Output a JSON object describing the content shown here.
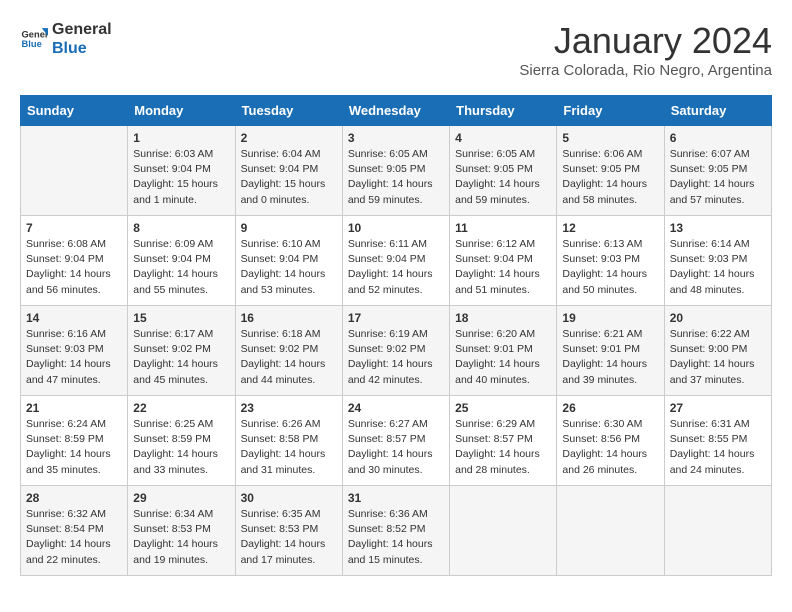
{
  "header": {
    "logo_general": "General",
    "logo_blue": "Blue",
    "month": "January 2024",
    "location": "Sierra Colorada, Rio Negro, Argentina"
  },
  "weekdays": [
    "Sunday",
    "Monday",
    "Tuesday",
    "Wednesday",
    "Thursday",
    "Friday",
    "Saturday"
  ],
  "weeks": [
    [
      {
        "day": "",
        "sunrise": "",
        "sunset": "",
        "daylight": ""
      },
      {
        "day": "1",
        "sunrise": "Sunrise: 6:03 AM",
        "sunset": "Sunset: 9:04 PM",
        "daylight": "Daylight: 15 hours and 1 minute."
      },
      {
        "day": "2",
        "sunrise": "Sunrise: 6:04 AM",
        "sunset": "Sunset: 9:04 PM",
        "daylight": "Daylight: 15 hours and 0 minutes."
      },
      {
        "day": "3",
        "sunrise": "Sunrise: 6:05 AM",
        "sunset": "Sunset: 9:05 PM",
        "daylight": "Daylight: 14 hours and 59 minutes."
      },
      {
        "day": "4",
        "sunrise": "Sunrise: 6:05 AM",
        "sunset": "Sunset: 9:05 PM",
        "daylight": "Daylight: 14 hours and 59 minutes."
      },
      {
        "day": "5",
        "sunrise": "Sunrise: 6:06 AM",
        "sunset": "Sunset: 9:05 PM",
        "daylight": "Daylight: 14 hours and 58 minutes."
      },
      {
        "day": "6",
        "sunrise": "Sunrise: 6:07 AM",
        "sunset": "Sunset: 9:05 PM",
        "daylight": "Daylight: 14 hours and 57 minutes."
      }
    ],
    [
      {
        "day": "7",
        "sunrise": "Sunrise: 6:08 AM",
        "sunset": "Sunset: 9:04 PM",
        "daylight": "Daylight: 14 hours and 56 minutes."
      },
      {
        "day": "8",
        "sunrise": "Sunrise: 6:09 AM",
        "sunset": "Sunset: 9:04 PM",
        "daylight": "Daylight: 14 hours and 55 minutes."
      },
      {
        "day": "9",
        "sunrise": "Sunrise: 6:10 AM",
        "sunset": "Sunset: 9:04 PM",
        "daylight": "Daylight: 14 hours and 53 minutes."
      },
      {
        "day": "10",
        "sunrise": "Sunrise: 6:11 AM",
        "sunset": "Sunset: 9:04 PM",
        "daylight": "Daylight: 14 hours and 52 minutes."
      },
      {
        "day": "11",
        "sunrise": "Sunrise: 6:12 AM",
        "sunset": "Sunset: 9:04 PM",
        "daylight": "Daylight: 14 hours and 51 minutes."
      },
      {
        "day": "12",
        "sunrise": "Sunrise: 6:13 AM",
        "sunset": "Sunset: 9:03 PM",
        "daylight": "Daylight: 14 hours and 50 minutes."
      },
      {
        "day": "13",
        "sunrise": "Sunrise: 6:14 AM",
        "sunset": "Sunset: 9:03 PM",
        "daylight": "Daylight: 14 hours and 48 minutes."
      }
    ],
    [
      {
        "day": "14",
        "sunrise": "Sunrise: 6:16 AM",
        "sunset": "Sunset: 9:03 PM",
        "daylight": "Daylight: 14 hours and 47 minutes."
      },
      {
        "day": "15",
        "sunrise": "Sunrise: 6:17 AM",
        "sunset": "Sunset: 9:02 PM",
        "daylight": "Daylight: 14 hours and 45 minutes."
      },
      {
        "day": "16",
        "sunrise": "Sunrise: 6:18 AM",
        "sunset": "Sunset: 9:02 PM",
        "daylight": "Daylight: 14 hours and 44 minutes."
      },
      {
        "day": "17",
        "sunrise": "Sunrise: 6:19 AM",
        "sunset": "Sunset: 9:02 PM",
        "daylight": "Daylight: 14 hours and 42 minutes."
      },
      {
        "day": "18",
        "sunrise": "Sunrise: 6:20 AM",
        "sunset": "Sunset: 9:01 PM",
        "daylight": "Daylight: 14 hours and 40 minutes."
      },
      {
        "day": "19",
        "sunrise": "Sunrise: 6:21 AM",
        "sunset": "Sunset: 9:01 PM",
        "daylight": "Daylight: 14 hours and 39 minutes."
      },
      {
        "day": "20",
        "sunrise": "Sunrise: 6:22 AM",
        "sunset": "Sunset: 9:00 PM",
        "daylight": "Daylight: 14 hours and 37 minutes."
      }
    ],
    [
      {
        "day": "21",
        "sunrise": "Sunrise: 6:24 AM",
        "sunset": "Sunset: 8:59 PM",
        "daylight": "Daylight: 14 hours and 35 minutes."
      },
      {
        "day": "22",
        "sunrise": "Sunrise: 6:25 AM",
        "sunset": "Sunset: 8:59 PM",
        "daylight": "Daylight: 14 hours and 33 minutes."
      },
      {
        "day": "23",
        "sunrise": "Sunrise: 6:26 AM",
        "sunset": "Sunset: 8:58 PM",
        "daylight": "Daylight: 14 hours and 31 minutes."
      },
      {
        "day": "24",
        "sunrise": "Sunrise: 6:27 AM",
        "sunset": "Sunset: 8:57 PM",
        "daylight": "Daylight: 14 hours and 30 minutes."
      },
      {
        "day": "25",
        "sunrise": "Sunrise: 6:29 AM",
        "sunset": "Sunset: 8:57 PM",
        "daylight": "Daylight: 14 hours and 28 minutes."
      },
      {
        "day": "26",
        "sunrise": "Sunrise: 6:30 AM",
        "sunset": "Sunset: 8:56 PM",
        "daylight": "Daylight: 14 hours and 26 minutes."
      },
      {
        "day": "27",
        "sunrise": "Sunrise: 6:31 AM",
        "sunset": "Sunset: 8:55 PM",
        "daylight": "Daylight: 14 hours and 24 minutes."
      }
    ],
    [
      {
        "day": "28",
        "sunrise": "Sunrise: 6:32 AM",
        "sunset": "Sunset: 8:54 PM",
        "daylight": "Daylight: 14 hours and 22 minutes."
      },
      {
        "day": "29",
        "sunrise": "Sunrise: 6:34 AM",
        "sunset": "Sunset: 8:53 PM",
        "daylight": "Daylight: 14 hours and 19 minutes."
      },
      {
        "day": "30",
        "sunrise": "Sunrise: 6:35 AM",
        "sunset": "Sunset: 8:53 PM",
        "daylight": "Daylight: 14 hours and 17 minutes."
      },
      {
        "day": "31",
        "sunrise": "Sunrise: 6:36 AM",
        "sunset": "Sunset: 8:52 PM",
        "daylight": "Daylight: 14 hours and 15 minutes."
      },
      {
        "day": "",
        "sunrise": "",
        "sunset": "",
        "daylight": ""
      },
      {
        "day": "",
        "sunrise": "",
        "sunset": "",
        "daylight": ""
      },
      {
        "day": "",
        "sunrise": "",
        "sunset": "",
        "daylight": ""
      }
    ]
  ]
}
